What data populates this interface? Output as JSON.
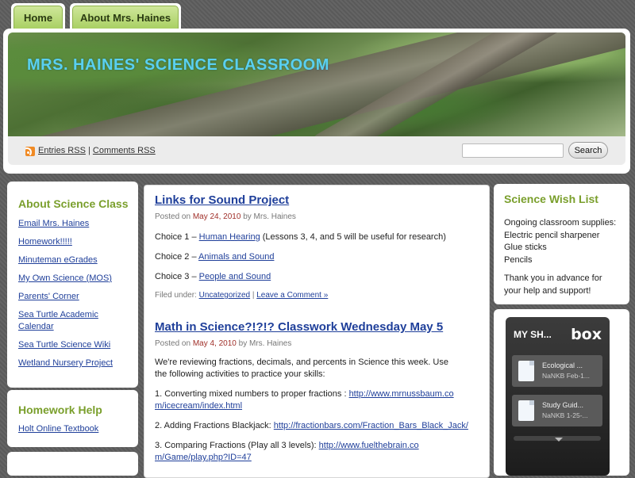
{
  "nav": {
    "tabs": [
      {
        "label": "Home"
      },
      {
        "label": "About Mrs. Haines"
      }
    ]
  },
  "header": {
    "site_title": "MRS. HAINES' SCIENCE CLASSROOM",
    "entries_rss": "Entries RSS",
    "separator": "|",
    "comments_rss": "Comments RSS",
    "search_placeholder": "",
    "search_button": "Search"
  },
  "sidebar_left": {
    "about": {
      "title": "About Science Class",
      "links": [
        "Email Mrs. Haines",
        "Homework!!!!!",
        "Minuteman eGrades",
        "My Own Science (MOS)",
        "Parents' Corner",
        "Sea Turtle Academic Calendar",
        "Sea Turtle Science Wiki",
        "Wetland Nursery Project"
      ]
    },
    "homework_help": {
      "title": "Homework Help",
      "links": [
        "Holt Online Textbook"
      ]
    }
  },
  "posts": [
    {
      "title": "Links for Sound Project",
      "posted_on": "Posted on",
      "date": "May 24, 2010",
      "by": "by Mrs. Haines",
      "lines": [
        {
          "prefix": "Choice 1 – ",
          "link": "Human Hearing",
          "suffix": " (Lessons 3, 4, and 5 will be useful for research)"
        },
        {
          "prefix": "Choice 2 – ",
          "link": "Animals and Sound",
          "suffix": ""
        },
        {
          "prefix": "Choice 3 – ",
          "link": "People and Sound",
          "suffix": ""
        }
      ],
      "filed_under": "Filed under:",
      "category": "Uncategorized",
      "sep": "|",
      "comment": "Leave a Comment »"
    },
    {
      "title": "Math in Science?!?!? Classwork Wednesday May 5",
      "posted_on": "Posted on",
      "date": "May 4, 2010",
      "by": "by Mrs. Haines",
      "intro": "We're reviewing fractions, decimals, and percents in Science this week.  Use the following activities to practice your skills:",
      "items": [
        {
          "text": "1.  Converting mixed numbers to proper fractions : ",
          "link": "http://www.mrnussbaum.com/icecream/index.html"
        },
        {
          "text": "2.  Adding Fractions Blackjack: ",
          "link": "http://fractionbars.com/Fraction_Bars_Black_Jack/"
        },
        {
          "text": "3. Comparing Fractions (Play all 3 levels): ",
          "link": "http://www.fuelthebrain.com/Game/play.php?ID=47"
        }
      ]
    }
  ],
  "sidebar_right": {
    "wish_list": {
      "title": "Science Wish List",
      "lines": [
        "Ongoing classroom supplies:",
        "Electric pencil sharpener",
        "Glue sticks",
        "Pencils"
      ],
      "thanks": "Thank you in advance for your help and support!"
    },
    "box_widget": {
      "header": "MY SH...",
      "logo": "box",
      "files": [
        {
          "name": "Ecological ...",
          "meta": "NaNKB Feb-1..."
        },
        {
          "name": "Study Guid...",
          "meta": "NaNKB 1-25-..."
        }
      ]
    }
  }
}
